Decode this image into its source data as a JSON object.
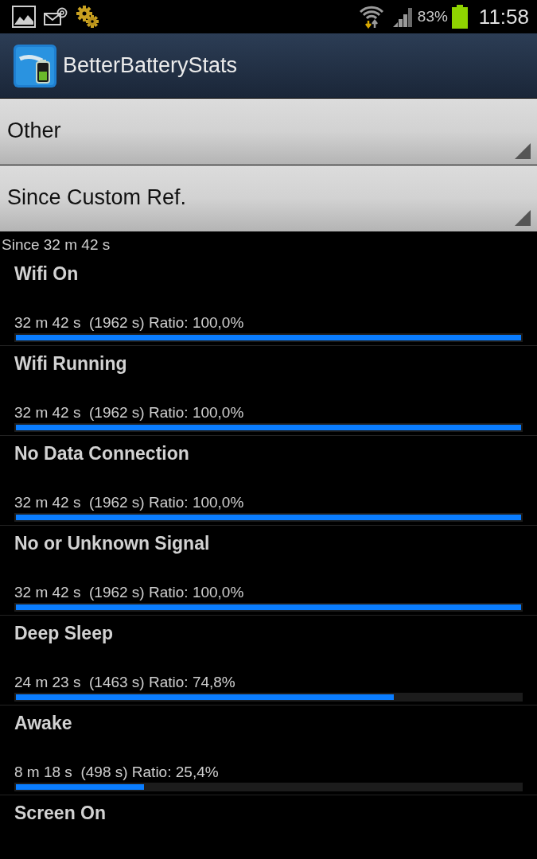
{
  "status_bar": {
    "battery": "83%",
    "time": "11:58"
  },
  "app_bar": {
    "title": "BetterBatteryStats"
  },
  "dropdowns": [
    {
      "value": "Other"
    },
    {
      "value": "Since Custom Ref."
    }
  ],
  "since": "Since 32 m 42 s",
  "rows": [
    {
      "name": "Wifi On",
      "detail": "32 m 42 s  (1962 s) Ratio: 100,0%",
      "level": 1.0
    },
    {
      "name": "Wifi Running",
      "detail": "32 m 42 s  (1962 s) Ratio: 100,0%",
      "level": 1.0
    },
    {
      "name": "No Data Connection",
      "detail": "32 m 42 s  (1962 s) Ratio: 100,0%",
      "level": 1.0
    },
    {
      "name": "No or Unknown Signal",
      "detail": "32 m 42 s  (1962 s) Ratio: 100,0%",
      "level": 1.0
    },
    {
      "name": "Deep Sleep",
      "detail": "24 m 23 s  (1463 s) Ratio: 74,8%",
      "level": 0.748
    },
    {
      "name": "Awake",
      "detail": "8 m 18 s  (498 s) Ratio: 25,4%",
      "level": 0.254
    },
    {
      "name": "Screen On"
    }
  ]
}
